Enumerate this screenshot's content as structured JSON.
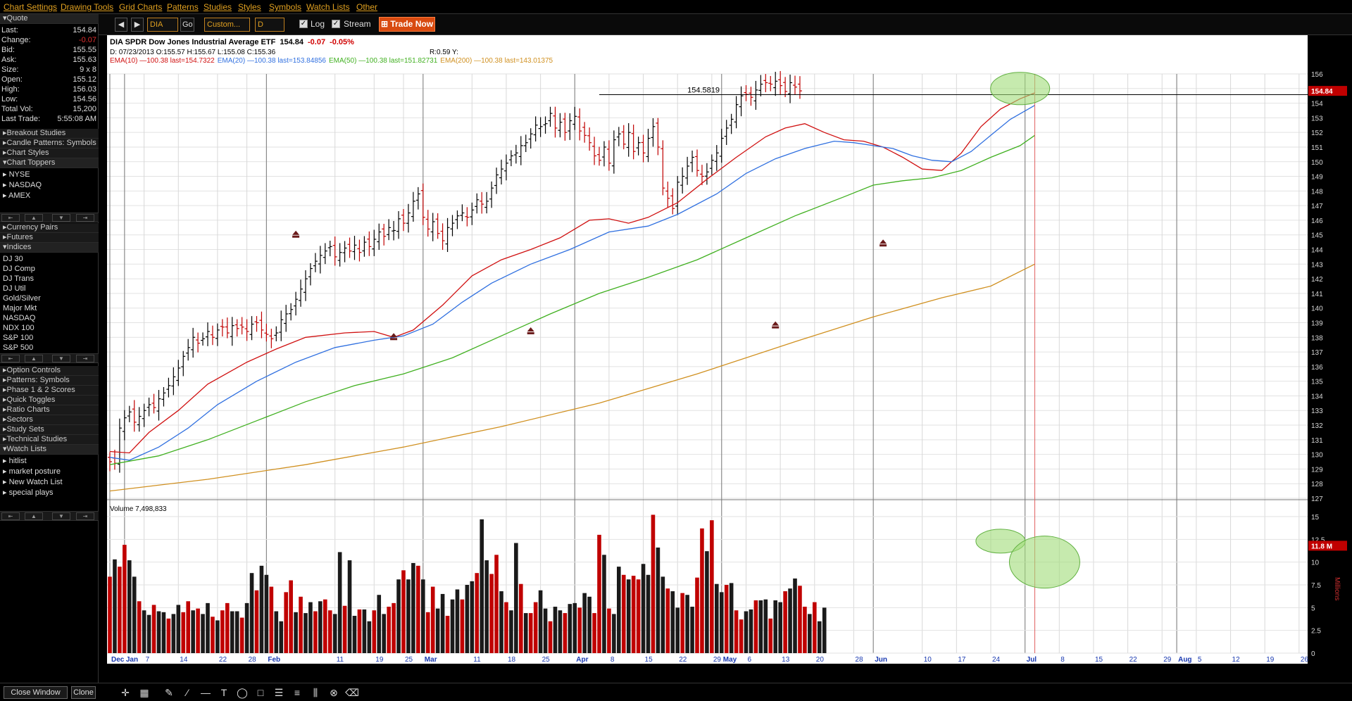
{
  "menu": [
    "Chart Settings",
    "Drawing Tools",
    "Grid Charts",
    "Patterns",
    "Studies",
    "Styles",
    "Symbols",
    "Watch Lists",
    "Other"
  ],
  "toolbar": {
    "symbol": "DIA",
    "go": "Go",
    "range": "Custom...",
    "period": "D",
    "log_label": "Log",
    "stream_label": "Stream",
    "trade_now": "Trade Now"
  },
  "quote": {
    "title": "Quote",
    "rows": [
      {
        "k": "Last:",
        "v": "154.84"
      },
      {
        "k": "Change:",
        "v": "-0.07"
      },
      {
        "k": "Bid:",
        "v": "155.55"
      },
      {
        "k": "Ask:",
        "v": "155.63"
      },
      {
        "k": "Size:",
        "v": "9 x 8"
      },
      {
        "k": "Open:",
        "v": "155.12"
      },
      {
        "k": "High:",
        "v": "156.03"
      },
      {
        "k": "Low:",
        "v": "154.56"
      },
      {
        "k": "Total Vol:",
        "v": "15,200"
      },
      {
        "k": "Last Trade:",
        "v": "5:55:08 AM"
      }
    ]
  },
  "sidebar": {
    "breakout": "Breakout Studies",
    "candle": "Candle Patterns: Symbols",
    "chart_styles": "Chart Styles",
    "chart_toppers": "Chart Toppers",
    "toppers_items": [
      "NYSE",
      "NASDAQ",
      "AMEX"
    ],
    "currency": "Currency Pairs",
    "futures": "Futures",
    "indices": "Indices",
    "indices_items": [
      "DJ 30",
      "DJ Comp",
      "DJ Trans",
      "DJ Util",
      "Gold/Silver",
      "Major Mkt",
      "NASDAQ",
      "NDX 100",
      "S&P 100",
      "S&P 500"
    ],
    "more": [
      "Option Controls",
      "Patterns: Symbols",
      "Phase 1 & 2 Scores",
      "Quick Toggles",
      "Ratio Charts",
      "Sectors",
      "Study Sets",
      "Technical Studies"
    ],
    "watch": "Watch Lists",
    "watch_items": [
      "hitlist",
      "market posture",
      "New Watch List",
      "special plays"
    ]
  },
  "chart_header": {
    "symbol": "DIA SPDR Dow Jones Industrial Average ETF",
    "last": "154.84",
    "change": "-0.07",
    "change_pct": "-0.05%",
    "ohlc": "D: 07/23/2013 O:155.57 H:155.67 L:155.08 C:155.36",
    "ratio": "R:0.59 Y:",
    "ema": [
      {
        "text": "EMA(10) —100.38 last=154.7322",
        "color": "#d01010"
      },
      {
        "text": "EMA(20) —100.38 last=153.84856",
        "color": "#3070e0"
      },
      {
        "text": "EMA(50) —100.38 last=151.82731",
        "color": "#40b020"
      },
      {
        "text": "EMA(200) —100.38 last=143.01375",
        "color": "#d09020"
      }
    ],
    "peak_label": "154.5819",
    "last_tag": "154.84",
    "volume_label": "Volume 7,498,833",
    "vol_tag": "11.8 M",
    "millions": "Millions"
  },
  "chart_data": {
    "type": "bar",
    "ylim": [
      127,
      156
    ],
    "yticks": [
      127,
      128,
      129,
      130,
      131,
      132,
      133,
      134,
      135,
      136,
      137,
      138,
      139,
      140,
      141,
      142,
      143,
      144,
      145,
      146,
      147,
      148,
      149,
      150,
      151,
      152,
      153,
      154,
      155,
      156
    ],
    "xlabels": [
      {
        "t": "Dec",
        "d": 0,
        "b": 1
      },
      {
        "t": "Jan",
        "d": 3,
        "b": 1
      },
      {
        "t": "7",
        "d": 7
      },
      {
        "t": "14",
        "d": 14
      },
      {
        "t": "22",
        "d": 22
      },
      {
        "t": "28",
        "d": 28
      },
      {
        "t": "Feb",
        "d": 32,
        "b": 1
      },
      {
        "t": "11",
        "d": 46
      },
      {
        "t": "19",
        "d": 54
      },
      {
        "t": "25",
        "d": 60
      },
      {
        "t": "Mar",
        "d": 64,
        "b": 1
      },
      {
        "t": "11",
        "d": 74
      },
      {
        "t": "18",
        "d": 81
      },
      {
        "t": "25",
        "d": 88
      },
      {
        "t": "Apr",
        "d": 95,
        "b": 1
      },
      {
        "t": "8",
        "d": 102
      },
      {
        "t": "15",
        "d": 109
      },
      {
        "t": "22",
        "d": 116
      },
      {
        "t": "29",
        "d": 123
      },
      {
        "t": "May",
        "d": 125,
        "b": 1
      },
      {
        "t": "6",
        "d": 130
      },
      {
        "t": "13",
        "d": 137
      },
      {
        "t": "20",
        "d": 144
      },
      {
        "t": "28",
        "d": 152
      },
      {
        "t": "Jun",
        "d": 156,
        "b": 1
      },
      {
        "t": "10",
        "d": 166
      },
      {
        "t": "17",
        "d": 173
      },
      {
        "t": "24",
        "d": 180
      },
      {
        "t": "Jul",
        "d": 187,
        "b": 1
      },
      {
        "t": "8",
        "d": 194
      },
      {
        "t": "15",
        "d": 201
      },
      {
        "t": "22",
        "d": 208
      },
      {
        "t": "29",
        "d": 215
      },
      {
        "t": "Aug",
        "d": 218,
        "b": 1
      },
      {
        "t": "5",
        "d": 222
      },
      {
        "t": "12",
        "d": 229
      },
      {
        "t": "19",
        "d": 236
      },
      {
        "t": "26",
        "d": 243
      }
    ],
    "closes": [
      129.5,
      129.4,
      131.8,
      132.5,
      132.9,
      132.2,
      132.6,
      133.0,
      133.4,
      133.2,
      133.8,
      134.2,
      134.7,
      135.3,
      135.9,
      136.7,
      137.3,
      138.0,
      137.6,
      137.9,
      138.4,
      138.0,
      138.5,
      138.7,
      138.3,
      138.8,
      138.6,
      138.7,
      138.4,
      138.9,
      139.0,
      138.5,
      138.2,
      137.9,
      138.3,
      139.2,
      139.6,
      139.9,
      140.6,
      141.3,
      142.0,
      142.7,
      143.2,
      143.6,
      143.9,
      144.2,
      143.5,
      143.8,
      144.1,
      143.9,
      144.3,
      143.8,
      144.5,
      144.2,
      144.7,
      145.2,
      144.9,
      145.5,
      145.3,
      146.1,
      145.8,
      146.5,
      147.3,
      147.8,
      146.2,
      145.4,
      145.9,
      145.1,
      144.6,
      145.5,
      145.8,
      146.3,
      146.5,
      146.2,
      146.7,
      147.4,
      147.1,
      147.3,
      148.2,
      149.1,
      149.5,
      149.9,
      150.4,
      150.6,
      151.1,
      151.3,
      151.9,
      152.5,
      152.4,
      152.6,
      153.3,
      152.3,
      152.7,
      152.0,
      152.8,
      153.1,
      152.1,
      151.8,
      151.3,
      150.4,
      150.1,
      151.0,
      149.9,
      151.5,
      151.9,
      151.2,
      152.0,
      150.7,
      151.3,
      150.6,
      151.6,
      152.4,
      151.0,
      148.2,
      147.5,
      146.8,
      148.6,
      149.0,
      149.7,
      150.3,
      149.4,
      149.0,
      149.3,
      150.1,
      150.6,
      151.6,
      152.3,
      152.9,
      153.9,
      154.5,
      154.6,
      154.4,
      154.9,
      155.3,
      155.4,
      155.3,
      155.5,
      155.2,
      154.8,
      155.4,
      155.1,
      154.84
    ],
    "volume": [
      8.4,
      10.3,
      9.5,
      11.9,
      10.2,
      8.4,
      5.7,
      4.7,
      4.2,
      5.3,
      4.6,
      4.5,
      3.8,
      4.3,
      5.3,
      4.5,
      5.7,
      4.7,
      4.9,
      4.3,
      5.5,
      4.0,
      3.6,
      4.7,
      5.5,
      4.6,
      4.6,
      3.9,
      5.5,
      8.8,
      6.9,
      9.6,
      8.6,
      7.3,
      4.6,
      3.5,
      6.7,
      8.0,
      4.5,
      6.2,
      4.4,
      5.6,
      4.6,
      5.7,
      5.9,
      4.7,
      4.3,
      11.1,
      5.2,
      10.2,
      4.1,
      4.8,
      4.8,
      3.5,
      4.7,
      6.4,
      4.3,
      5.1,
      5.5,
      8.1,
      9.1,
      8.1,
      9.9,
      9.6,
      8.1,
      4.5,
      7.3,
      4.9,
      6.5,
      4.1,
      5.9,
      7.0,
      5.9,
      7.5,
      7.9,
      8.8,
      14.7,
      10.2,
      8.7,
      10.8,
      6.8,
      5.6,
      4.7,
      12.1,
      7.6,
      4.4,
      4.4,
      5.6,
      6.9,
      4.9,
      3.5,
      5.1,
      4.7,
      4.4,
      5.4,
      5.5,
      5.0,
      6.6,
      6.2,
      4.4,
      13.0,
      10.8,
      4.9,
      4.3,
      9.5,
      8.6,
      8.1,
      8.5,
      8.1,
      9.8,
      8.6,
      15.2,
      11.6,
      8.4,
      7.1,
      6.8,
      5.0,
      6.6,
      6.4,
      5.1,
      8.3,
      13.7,
      11.2,
      14.6,
      7.6,
      6.7,
      7.5,
      7.7,
      4.7,
      3.7,
      4.6,
      4.8,
      5.8,
      5.8,
      5.9,
      3.8,
      5.8,
      5.6,
      6.8,
      7.1,
      8.2,
      7.4,
      5.1,
      4.3,
      5.6,
      3.5,
      5.0
    ],
    "ema": [
      {
        "name": "EMA(10)",
        "color": "#d01010",
        "pts": [
          [
            0,
            130.2
          ],
          [
            4,
            130.1
          ],
          [
            8,
            131.5
          ],
          [
            14,
            133.0
          ],
          [
            20,
            134.8
          ],
          [
            28,
            136.3
          ],
          [
            34,
            137.2
          ],
          [
            40,
            138.0
          ],
          [
            48,
            138.3
          ],
          [
            54,
            138.4
          ],
          [
            58,
            138.0
          ],
          [
            62,
            138.5
          ],
          [
            68,
            140.2
          ],
          [
            74,
            142.2
          ],
          [
            80,
            143.3
          ],
          [
            86,
            144.0
          ],
          [
            92,
            144.8
          ],
          [
            98,
            146.0
          ],
          [
            102,
            146.1
          ],
          [
            106,
            145.8
          ],
          [
            110,
            146.2
          ],
          [
            116,
            147.2
          ],
          [
            122,
            148.8
          ],
          [
            128,
            150.3
          ],
          [
            134,
            151.7
          ],
          [
            138,
            152.3
          ],
          [
            142,
            152.6
          ],
          [
            146,
            152.0
          ],
          [
            150,
            151.5
          ],
          [
            154,
            151.4
          ],
          [
            158,
            151.0
          ],
          [
            162,
            150.3
          ],
          [
            166,
            149.5
          ],
          [
            170,
            149.4
          ],
          [
            174,
            150.6
          ],
          [
            178,
            152.4
          ],
          [
            182,
            153.6
          ],
          [
            186,
            154.3
          ],
          [
            189,
            154.7
          ]
        ]
      },
      {
        "name": "EMA(20)",
        "color": "#3070e0",
        "pts": [
          [
            0,
            129.8
          ],
          [
            4,
            129.6
          ],
          [
            10,
            130.5
          ],
          [
            16,
            131.8
          ],
          [
            22,
            133.4
          ],
          [
            30,
            135.0
          ],
          [
            38,
            136.3
          ],
          [
            46,
            137.3
          ],
          [
            54,
            137.8
          ],
          [
            60,
            138.1
          ],
          [
            66,
            138.9
          ],
          [
            72,
            140.4
          ],
          [
            78,
            141.7
          ],
          [
            86,
            143.0
          ],
          [
            94,
            144.0
          ],
          [
            102,
            145.2
          ],
          [
            110,
            145.6
          ],
          [
            116,
            146.4
          ],
          [
            124,
            147.8
          ],
          [
            130,
            149.2
          ],
          [
            136,
            150.2
          ],
          [
            142,
            150.9
          ],
          [
            148,
            151.4
          ],
          [
            152,
            151.3
          ],
          [
            156,
            151.1
          ],
          [
            160,
            150.9
          ],
          [
            164,
            150.4
          ],
          [
            168,
            150.1
          ],
          [
            172,
            150.0
          ],
          [
            176,
            150.7
          ],
          [
            180,
            151.8
          ],
          [
            184,
            152.9
          ],
          [
            189,
            153.85
          ]
        ]
      },
      {
        "name": "EMA(50)",
        "color": "#40b020",
        "pts": [
          [
            0,
            129.3
          ],
          [
            10,
            129.9
          ],
          [
            20,
            131.0
          ],
          [
            30,
            132.3
          ],
          [
            40,
            133.6
          ],
          [
            50,
            134.7
          ],
          [
            60,
            135.5
          ],
          [
            70,
            136.6
          ],
          [
            80,
            138.1
          ],
          [
            90,
            139.6
          ],
          [
            100,
            141.0
          ],
          [
            110,
            142.1
          ],
          [
            120,
            143.3
          ],
          [
            130,
            144.8
          ],
          [
            140,
            146.3
          ],
          [
            150,
            147.6
          ],
          [
            156,
            148.4
          ],
          [
            162,
            148.7
          ],
          [
            168,
            148.9
          ],
          [
            174,
            149.4
          ],
          [
            180,
            150.3
          ],
          [
            186,
            151.1
          ],
          [
            189,
            151.8
          ]
        ]
      },
      {
        "name": "EMA(200)",
        "color": "#d09020",
        "pts": [
          [
            0,
            127.5
          ],
          [
            20,
            128.3
          ],
          [
            40,
            129.3
          ],
          [
            60,
            130.5
          ],
          [
            80,
            131.9
          ],
          [
            100,
            133.5
          ],
          [
            120,
            135.5
          ],
          [
            140,
            137.7
          ],
          [
            156,
            139.4
          ],
          [
            170,
            140.7
          ],
          [
            180,
            141.5
          ],
          [
            189,
            143.0
          ]
        ]
      }
    ],
    "markers": [
      [
        38,
        145
      ],
      [
        58,
        138
      ],
      [
        86,
        138.4
      ],
      [
        136,
        138.8
      ],
      [
        158,
        144.4
      ]
    ]
  }
}
